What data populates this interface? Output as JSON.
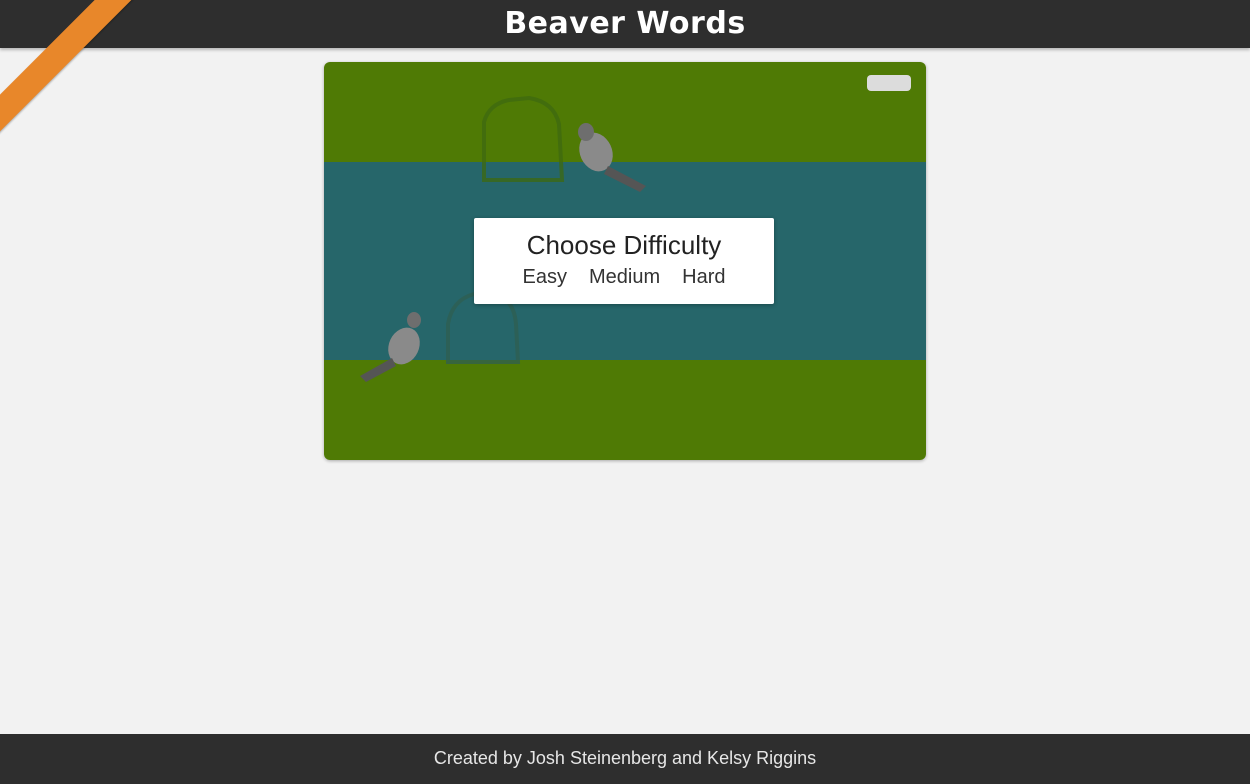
{
  "header": {
    "title": "Beaver Words"
  },
  "game": {
    "pause_icon": "pause-icon",
    "difficulty": {
      "title": "Choose Difficulty",
      "options": [
        "Easy",
        "Medium",
        "Hard"
      ]
    }
  },
  "footer": {
    "text": "Created by Josh Steinenberg and Kelsy Riggins"
  },
  "colors": {
    "header_bg": "#2e2e2e",
    "page_bg": "#f2f2f2",
    "grass": "#4f7a05",
    "water": "#26666a",
    "ribbon": "#e8872a"
  }
}
